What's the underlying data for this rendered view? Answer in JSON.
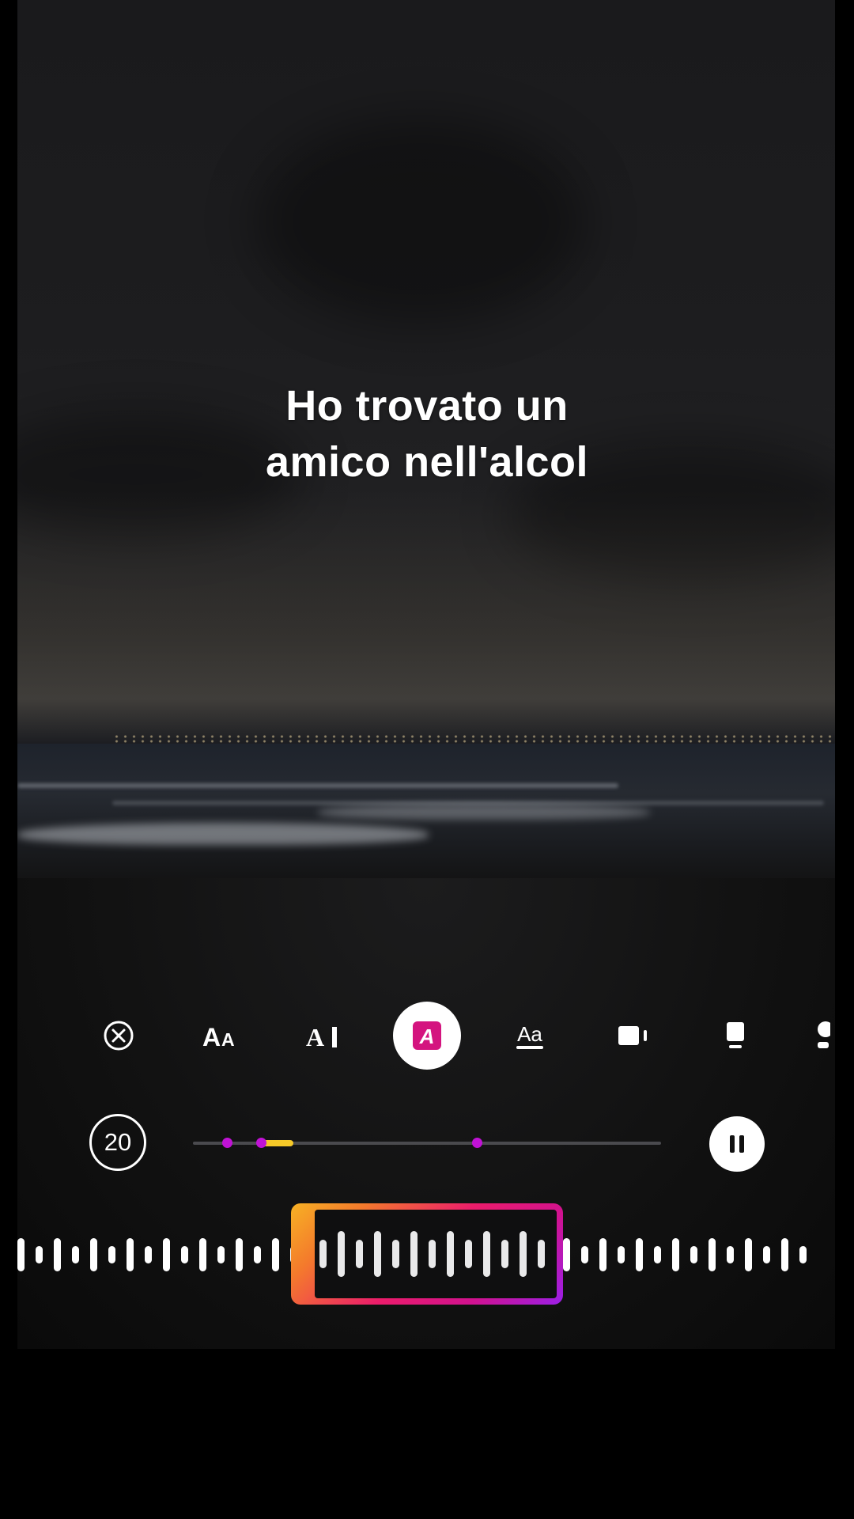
{
  "caption": {
    "line1": "Ho trovato un",
    "line2": "amico nell'alcol"
  },
  "toolbar": {
    "tools": [
      {
        "name": "remove-effect",
        "icon": "close-circle-icon"
      },
      {
        "name": "text-size",
        "icon": "text-size-icon",
        "glyph": "AA"
      },
      {
        "name": "text-cursor",
        "icon": "text-cursor-icon",
        "glyph": "A"
      },
      {
        "name": "text-style-highlight",
        "icon": "highlight-text-icon",
        "glyph": "A",
        "active": true
      },
      {
        "name": "text-underline",
        "icon": "underline-text-icon",
        "glyph": "Aa"
      },
      {
        "name": "align-right",
        "icon": "align-block-icon"
      },
      {
        "name": "align-bottom",
        "icon": "align-bottom-icon"
      },
      {
        "name": "more",
        "icon": "partial-icon"
      }
    ]
  },
  "player": {
    "duration_label": "20",
    "progress_start": 0.145,
    "progress_end": 0.215,
    "markers": [
      0.072,
      0.145,
      0.606
    ],
    "state": "playing"
  },
  "waveform": {
    "selection_start": 0.346,
    "selection_end": 0.668
  },
  "colors": {
    "accent_pink": "#ec1c6b",
    "accent_purple": "#9b1fe8",
    "accent_orange": "#f7b224",
    "progress_yellow": "#f6c928",
    "marker_magenta": "#c112d6",
    "active_tool_bg": "#d4147f"
  }
}
